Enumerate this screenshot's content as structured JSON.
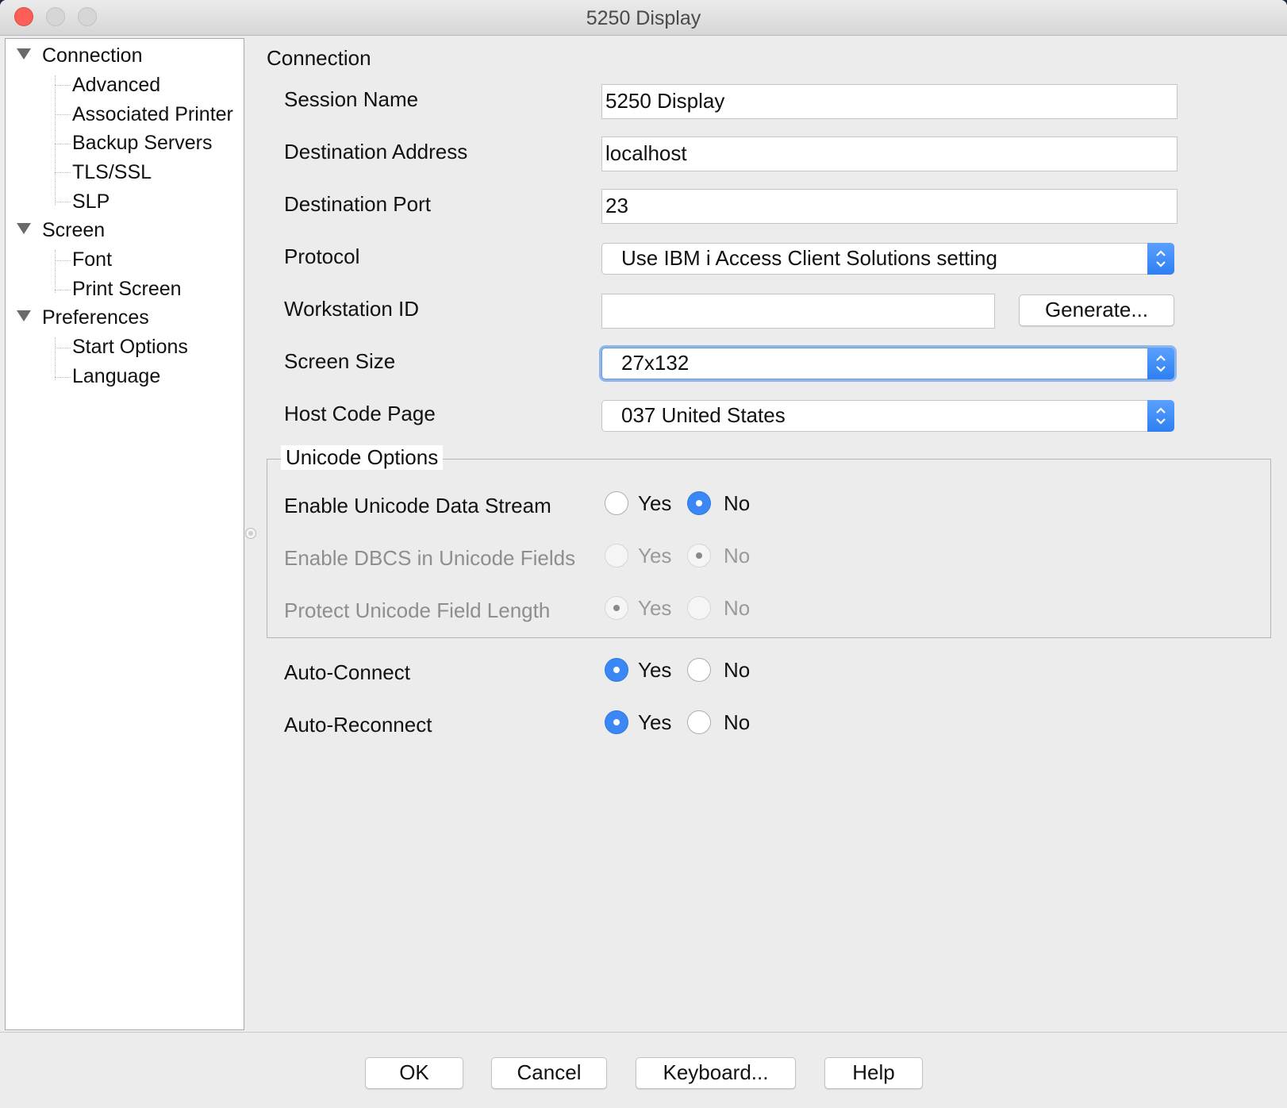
{
  "window": {
    "title": "5250 Display"
  },
  "sidebar": {
    "groups": [
      {
        "label": "Connection",
        "items": [
          "Advanced",
          "Associated Printer",
          "Backup Servers",
          "TLS/SSL",
          "SLP"
        ]
      },
      {
        "label": "Screen",
        "items": [
          "Font",
          "Print Screen"
        ]
      },
      {
        "label": "Preferences",
        "items": [
          "Start Options",
          "Language"
        ]
      }
    ]
  },
  "panel": {
    "title": "Connection",
    "session_name": {
      "label": "Session Name",
      "value": "5250 Display"
    },
    "destination_address": {
      "label": "Destination Address",
      "value": "localhost"
    },
    "destination_port": {
      "label": "Destination Port",
      "value": "23"
    },
    "protocol": {
      "label": "Protocol",
      "value": "Use IBM i Access Client Solutions setting"
    },
    "workstation_id": {
      "label": "Workstation ID",
      "value": "",
      "button": "Generate..."
    },
    "screen_size": {
      "label": "Screen Size",
      "value": "27x132"
    },
    "host_code_page": {
      "label": "Host Code Page",
      "value": "037 United States"
    },
    "unicode_options": {
      "title": "Unicode Options",
      "enable_unicode": {
        "label": "Enable Unicode Data Stream",
        "yes": "Yes",
        "no": "No",
        "selected": "no",
        "enabled": true
      },
      "enable_dbcs": {
        "label": "Enable DBCS in Unicode Fields",
        "yes": "Yes",
        "no": "No",
        "selected": "no",
        "enabled": false
      },
      "protect_length": {
        "label": "Protect Unicode Field Length",
        "yes": "Yes",
        "no": "No",
        "selected": "yes",
        "enabled": false
      }
    },
    "auto_connect": {
      "label": "Auto-Connect",
      "yes": "Yes",
      "no": "No",
      "selected": "yes"
    },
    "auto_reconnect": {
      "label": "Auto-Reconnect",
      "yes": "Yes",
      "no": "No",
      "selected": "yes"
    }
  },
  "footer": {
    "ok": "OK",
    "cancel": "Cancel",
    "keyboard": "Keyboard...",
    "help": "Help"
  },
  "colors": {
    "accent": "#3a87f5",
    "close_button": "#fc5f57"
  }
}
